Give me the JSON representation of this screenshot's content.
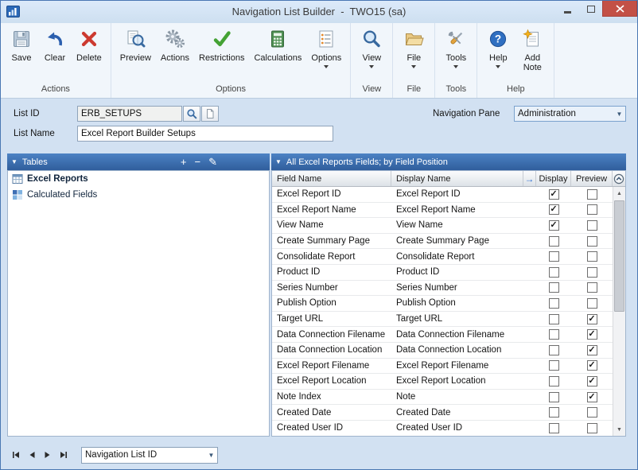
{
  "window": {
    "title": "Navigation List Builder  -  TWO15 (sa)"
  },
  "toolbar": {
    "groups": [
      {
        "label": "Actions",
        "buttons": [
          {
            "label": "Save"
          },
          {
            "label": "Clear"
          },
          {
            "label": "Delete"
          }
        ]
      },
      {
        "label": "Options",
        "buttons": [
          {
            "label": "Preview"
          },
          {
            "label": "Actions"
          },
          {
            "label": "Restrictions"
          },
          {
            "label": "Calculations"
          },
          {
            "label": "Options",
            "dropdown": true
          }
        ]
      },
      {
        "label": "View",
        "buttons": [
          {
            "label": "View",
            "dropdown": true
          }
        ]
      },
      {
        "label": "File",
        "buttons": [
          {
            "label": "File",
            "dropdown": true
          }
        ]
      },
      {
        "label": "Tools",
        "buttons": [
          {
            "label": "Tools",
            "dropdown": true
          }
        ]
      },
      {
        "label": "Help",
        "buttons": [
          {
            "label": "Help",
            "dropdown": true
          },
          {
            "label": "Add Note"
          }
        ]
      }
    ]
  },
  "form": {
    "list_id": {
      "label": "List ID",
      "value": "ERB_SETUPS"
    },
    "list_name": {
      "label": "List Name",
      "value": "Excel Report Builder Setups"
    },
    "navigation_pane": {
      "label": "Navigation Pane",
      "value": "Administration"
    }
  },
  "tables_panel": {
    "title": "Tables",
    "header_buttons": {
      "add": "+",
      "remove": "−",
      "edit": "✎"
    },
    "items": [
      {
        "label": "Excel Reports",
        "selected": true
      },
      {
        "label": "Calculated Fields",
        "selected": false
      }
    ]
  },
  "fields_panel": {
    "title": "All Excel Reports Fields; by Field Position",
    "columns": {
      "field_name": "Field Name",
      "display_name": "Display Name",
      "display": "Display",
      "preview": "Preview"
    },
    "rows": [
      {
        "field_name": "Excel Report ID",
        "display_name": "Excel Report ID",
        "display": true,
        "preview": false
      },
      {
        "field_name": "Excel Report Name",
        "display_name": "Excel Report Name",
        "display": true,
        "preview": false
      },
      {
        "field_name": "View Name",
        "display_name": "View Name",
        "display": true,
        "preview": false
      },
      {
        "field_name": "Create Summary Page",
        "display_name": "Create Summary Page",
        "display": false,
        "preview": false
      },
      {
        "field_name": "Consolidate Report",
        "display_name": "Consolidate Report",
        "display": false,
        "preview": false
      },
      {
        "field_name": "Product ID",
        "display_name": "Product ID",
        "display": false,
        "preview": false
      },
      {
        "field_name": "Series Number",
        "display_name": "Series Number",
        "display": false,
        "preview": false
      },
      {
        "field_name": "Publish Option",
        "display_name": "Publish Option",
        "display": false,
        "preview": false
      },
      {
        "field_name": "Target URL",
        "display_name": "Target URL",
        "display": false,
        "preview": true
      },
      {
        "field_name": "Data Connection Filename",
        "display_name": "Data Connection Filename",
        "display": false,
        "preview": true
      },
      {
        "field_name": "Data Connection Location",
        "display_name": "Data Connection Location",
        "display": false,
        "preview": true
      },
      {
        "field_name": "Excel Report Filename",
        "display_name": "Excel Report Filename",
        "display": false,
        "preview": true
      },
      {
        "field_name": "Excel Report Location",
        "display_name": "Excel Report Location",
        "display": false,
        "preview": true
      },
      {
        "field_name": "Note Index",
        "display_name": "Note",
        "display": false,
        "preview": true
      },
      {
        "field_name": "Created Date",
        "display_name": "Created Date",
        "display": false,
        "preview": false
      },
      {
        "field_name": "Created User ID",
        "display_name": "Created User ID",
        "display": false,
        "preview": false
      }
    ]
  },
  "footer": {
    "navigation_list_label": "Navigation List ID"
  },
  "icons": {
    "check": "✓",
    "up_arrow": "▲",
    "down_arrow": "▼",
    "combo_arrow": "▼",
    "header_arrow": "→",
    "pane_menu_arrow": "▼"
  }
}
